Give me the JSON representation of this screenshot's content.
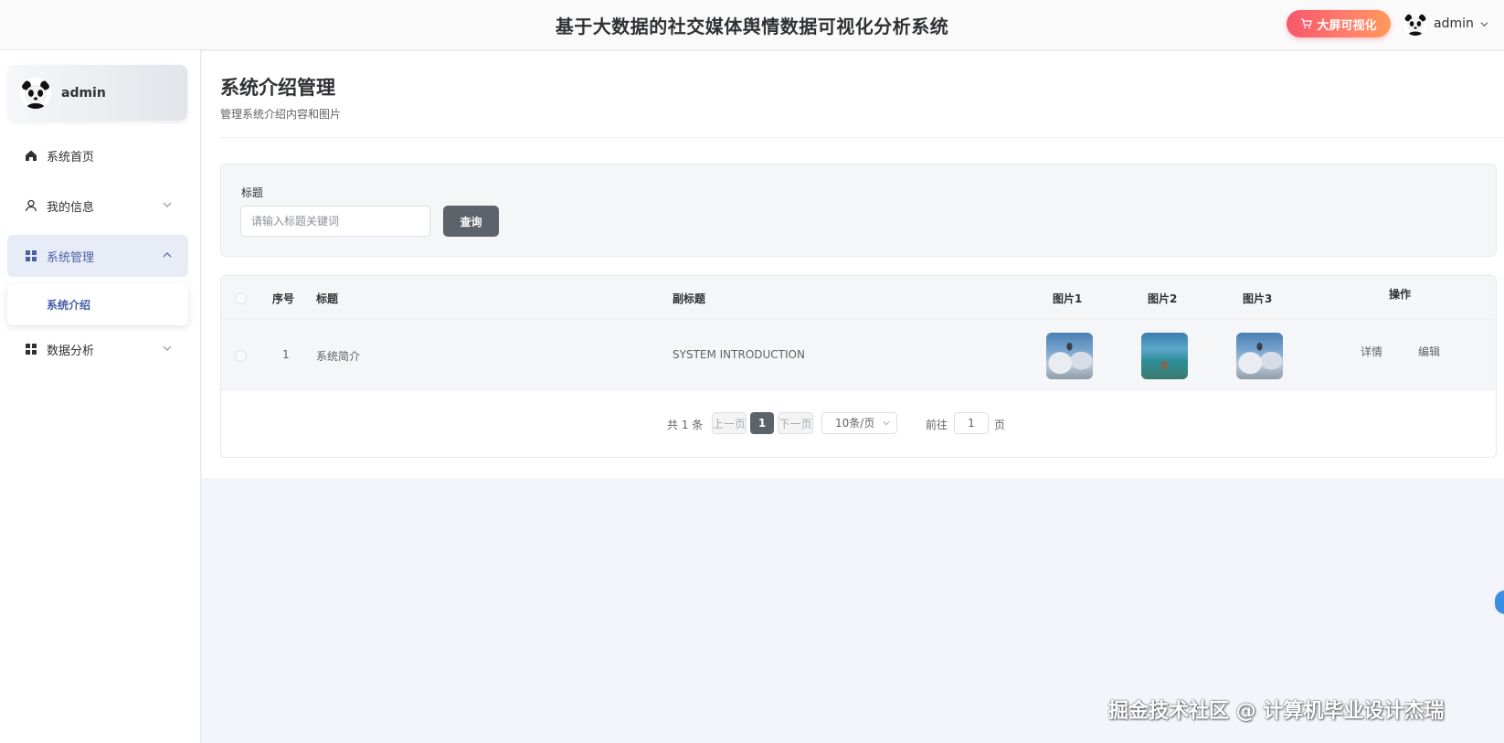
{
  "header": {
    "title": "基于大数据的社交媒体舆情数据可视化分析系统",
    "bigscreen_label": "大屏可视化",
    "username": "admin",
    "accent": "#f5576c"
  },
  "sidebar": {
    "username": "admin",
    "items": [
      {
        "label": "系统首页",
        "icon": "home-icon"
      },
      {
        "label": "我的信息",
        "icon": "user-icon"
      },
      {
        "label": "系统管理",
        "icon": "grid-icon",
        "active": true
      },
      {
        "label": "数据分析",
        "icon": "grid-icon"
      }
    ],
    "submenu": {
      "label": "系统介绍"
    },
    "active_color": "#4a5fa8"
  },
  "page": {
    "title": "系统介绍管理",
    "subtitle": "管理系统介绍内容和图片"
  },
  "search": {
    "label": "标题",
    "placeholder": "请输入标题关键词",
    "value": "",
    "button": "查询"
  },
  "table": {
    "headers": {
      "index": "序号",
      "title": "标题",
      "subtitle": "副标题",
      "img1": "图片1",
      "img2": "图片2",
      "img3": "图片3",
      "actions": "操作"
    },
    "rows": [
      {
        "index": "1",
        "title": "系统简介",
        "subtitle": "SYSTEM INTRODUCTION",
        "detail": "详情",
        "edit": "编辑"
      }
    ]
  },
  "pagination": {
    "total": "共 1 条",
    "prev": "上一页",
    "current": "1",
    "next": "下一页",
    "page_size": "10条/页",
    "goto": "前往",
    "goto_value": "1",
    "page_unit": "页"
  },
  "watermark": "掘金技术社区 @ 计算机毕业设计杰瑞"
}
